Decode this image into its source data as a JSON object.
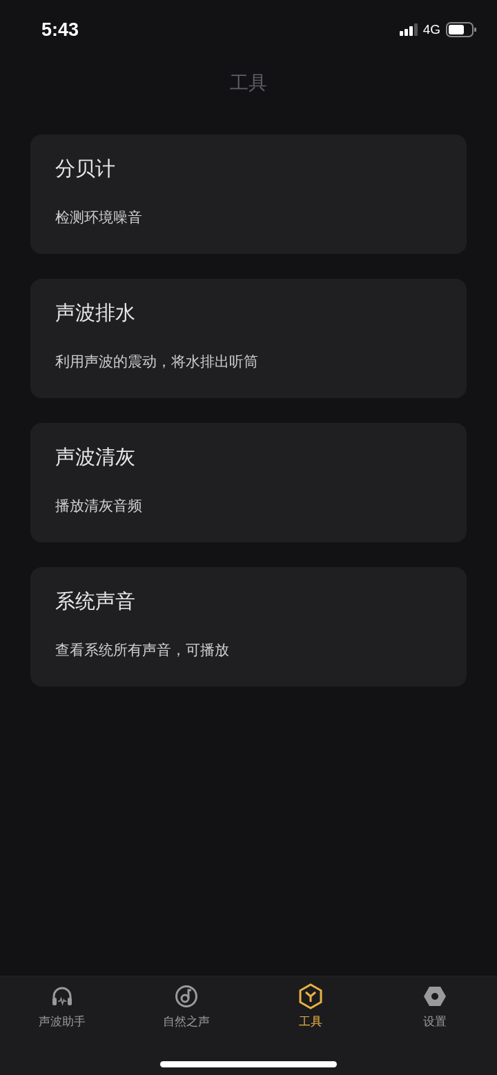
{
  "status_bar": {
    "time": "5:43",
    "network": "4G"
  },
  "header": {
    "title": "工具"
  },
  "tools": [
    {
      "title": "分贝计",
      "description": "检测环境噪音"
    },
    {
      "title": "声波排水",
      "description": "利用声波的震动，将水排出听筒"
    },
    {
      "title": "声波清灰",
      "description": "播放清灰音频"
    },
    {
      "title": "系统声音",
      "description": "查看系统所有声音，可播放"
    }
  ],
  "tab_bar": [
    {
      "label": "声波助手",
      "selected": false
    },
    {
      "label": "自然之声",
      "selected": false
    },
    {
      "label": "工具",
      "selected": true
    },
    {
      "label": "设置",
      "selected": false
    }
  ]
}
